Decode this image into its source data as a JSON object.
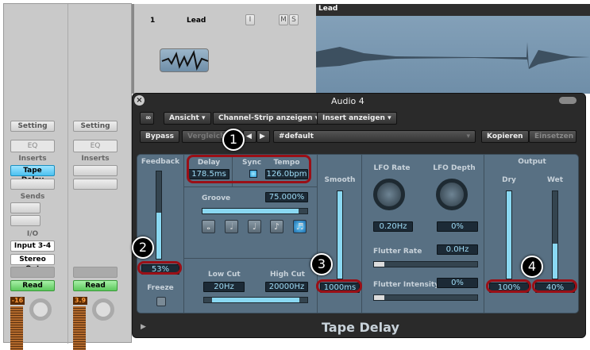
{
  "mixer": {
    "strips": [
      {
        "setting": "Setting",
        "eq": "EQ",
        "inserts_label": "Inserts",
        "insert1": "Tape Delay",
        "sends_label": "Sends",
        "io_label": "I/O",
        "input": "Input 3-4",
        "output": "Stereo Out",
        "automation": "Read",
        "meter_value": "-16"
      },
      {
        "setting": "Setting",
        "eq": "EQ",
        "inserts_label": "Inserts",
        "automation": "Read",
        "meter_value": "3.9"
      }
    ]
  },
  "track": {
    "number": "1",
    "name": "Lead",
    "input_btn": "I",
    "mute_btn": "M",
    "solo_btn": "S"
  },
  "region": {
    "name": "Lead"
  },
  "plugin": {
    "window_title": "Audio 4",
    "toolbar": {
      "view": "Ansicht",
      "channel_strip": "Channel-Strip anzeigen",
      "insert": "Insert anzeigen",
      "bypass": "Bypass",
      "compare": "Vergleich",
      "preset": "#default",
      "copy": "Kopieren",
      "paste": "Einsetzen"
    },
    "feedback": {
      "label": "Feedback",
      "value": "53%",
      "level": 0.53,
      "freeze": "Freeze"
    },
    "delay": {
      "label": "Delay",
      "value": "178.5ms"
    },
    "sync": {
      "label": "Sync",
      "on": true
    },
    "tempo": {
      "label": "Tempo",
      "value": "126.0bpm"
    },
    "groove": {
      "label": "Groove",
      "value": "75.000%",
      "level": 0.92
    },
    "notes": [
      "𝅝",
      "𝅗𝅥",
      "♩",
      "♪",
      "♬"
    ],
    "low_cut": {
      "label": "Low Cut",
      "value": "20Hz"
    },
    "high_cut": {
      "label": "High Cut",
      "value": "20000Hz"
    },
    "smooth": {
      "label": "Smooth",
      "value": "1000ms",
      "level": 1.0
    },
    "lfo_rate": {
      "label": "LFO Rate",
      "value": "0.20Hz"
    },
    "lfo_depth": {
      "label": "LFO Depth",
      "value": "0%"
    },
    "flutter_rate": {
      "label": "Flutter Rate",
      "value": "0.0Hz"
    },
    "flutter_intensity": {
      "label": "Flutter Intensity",
      "value": "0%"
    },
    "output": {
      "label": "Output",
      "dry_label": "Dry",
      "dry_value": "100%",
      "dry_level": 1.0,
      "wet_label": "Wet",
      "wet_value": "40%",
      "wet_level": 0.4
    },
    "name": "Tape Delay"
  },
  "annotations": [
    "1",
    "2",
    "3",
    "4"
  ]
}
